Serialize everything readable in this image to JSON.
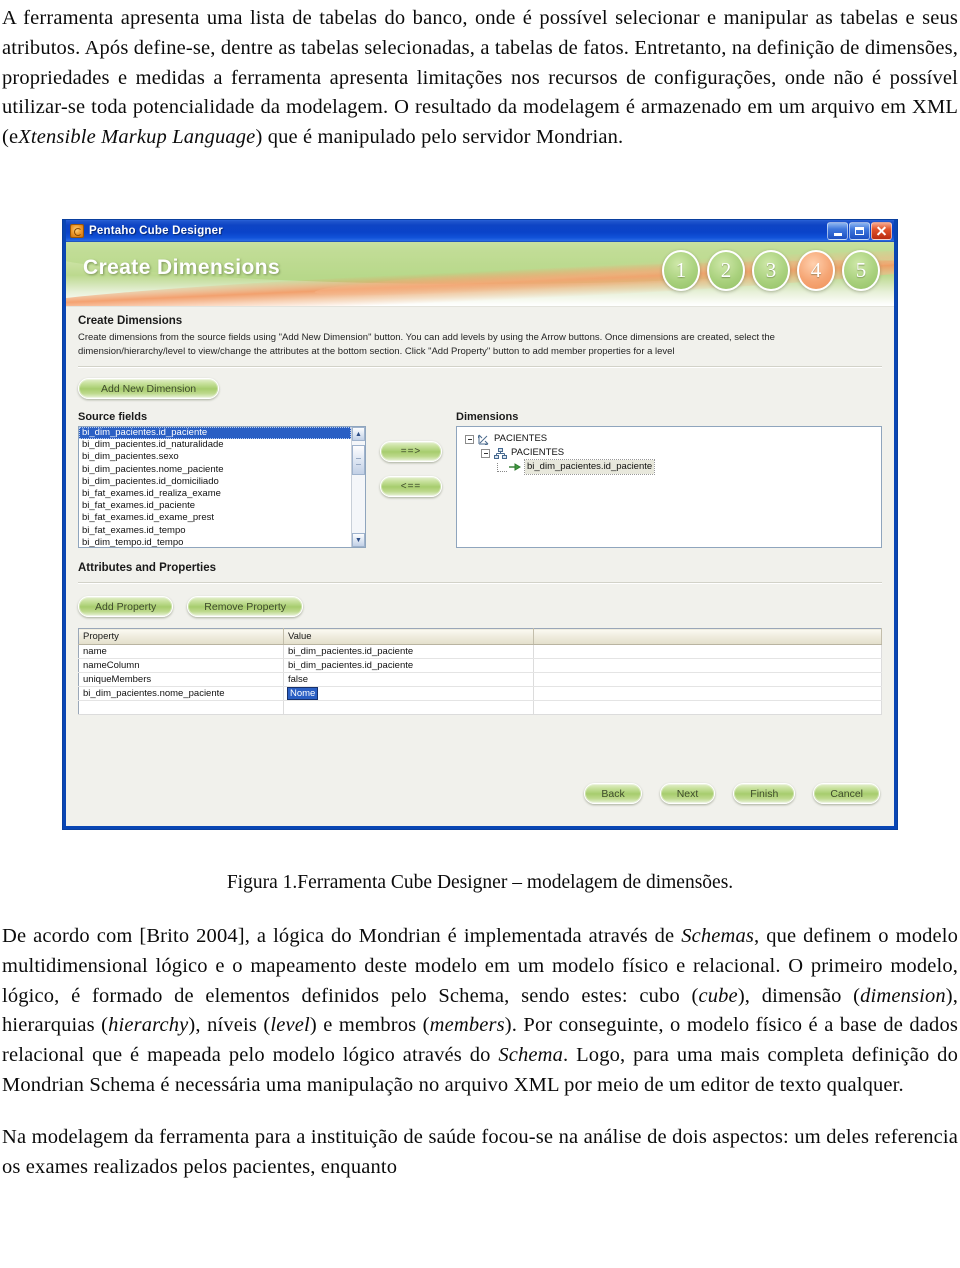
{
  "document": {
    "paragraph_top": "A ferramenta apresenta uma lista de tabelas do banco, onde é possível selecionar e manipular as tabelas e seus atributos. Após define-se, dentre as tabelas selecionadas, a tabelas de fatos. Entretanto, na definição de dimensões, propriedades e medidas a ferramenta apresenta limitações nos recursos de configurações, onde não é possível utilizar-se toda potencialidade da modelagem. O resultado da modelagem é armazenado em um arquivo em XML (eXtensible Markup Language) que é manipulado pelo servidor Mondrian.",
    "figure_caption": "Figura 1.Ferramenta Cube Designer – modelagem de dimensões.",
    "paragraph_after_1": "De acordo com [Brito 2004], a lógica do Mondrian é implementada através de Schemas, que definem o modelo multidimensional lógico e o mapeamento deste modelo em um modelo físico e relacional. O primeiro modelo, lógico, é formado de elementos definidos pelo Schema, sendo estes: cubo (cube), dimensão (dimension), hierarquias (hierarchy), níveis (level) e membros (members). Por conseguinte, o modelo físico é a base de dados relacional que é mapeada pelo modelo lógico através do Schema. Logo, para uma mais completa definição do Mondrian Schema é necessária uma manipulação no arquivo XML por meio de um editor de texto qualquer.",
    "paragraph_after_2": "Na modelagem da ferramenta para a instituição de saúde focou-se na análise de dois aspectos: um deles referencia os exames realizados pelos pacientes, enquanto"
  },
  "app": {
    "window_title": "Pentaho Cube Designer",
    "window_controls": {
      "minimize": "Minimize",
      "maximize": "Maximize",
      "close": "Close"
    },
    "banner": {
      "title": "Create Dimensions",
      "steps": [
        {
          "label": "1",
          "state": "inactive"
        },
        {
          "label": "2",
          "state": "inactive"
        },
        {
          "label": "3",
          "state": "inactive"
        },
        {
          "label": "4",
          "state": "active"
        },
        {
          "label": "5",
          "state": "inactive"
        }
      ],
      "active_color": "#f5a574",
      "inactive_color": "#a9d17d"
    },
    "section": {
      "heading": "Create Dimensions",
      "help": "Create dimensions from the source fields using \"Add New Dimension\" button. You can add levels by using the Arrow buttons. Once dimensions are created, select the dimension/hierarchy/level to view/change the attributes at the bottom section. Click \"Add Property\" button to add member properties for a level"
    },
    "add_new_dimension_label": "Add New Dimension",
    "source_fields": {
      "label": "Source fields",
      "items": [
        "bi_dim_pacientes.id_paciente",
        "bi_dim_pacientes.id_naturalidade",
        "bi_dim_pacientes.sexo",
        "bi_dim_pacientes.nome_paciente",
        "bi_dim_pacientes.id_domiciliado",
        "bi_fat_exames.id_realiza_exame",
        "bi_fat_exames.id_paciente",
        "bi_fat_exames.id_exame_prest",
        "bi_fat_exames.id_tempo",
        "bi_dim_tempo.id_tempo"
      ],
      "selected_index": 0
    },
    "transfer_buttons": {
      "add": "==>",
      "remove": "<=="
    },
    "dimensions": {
      "label": "Dimensions",
      "tree": [
        {
          "level": 1,
          "label": "PACIENTES",
          "icon": "dimension-icon",
          "expanded": true
        },
        {
          "level": 2,
          "label": "PACIENTES",
          "icon": "hierarchy-icon",
          "expanded": true
        },
        {
          "level": 3,
          "label": "bi_dim_pacientes.id_paciente",
          "icon": "level-icon",
          "selected": true
        }
      ]
    },
    "attributes": {
      "heading": "Attributes and Properties",
      "add_property_label": "Add Property",
      "remove_property_label": "Remove Property",
      "columns": [
        "Property",
        "Value",
        ""
      ],
      "rows": [
        {
          "property": "name",
          "value": "bi_dim_pacientes.id_paciente",
          "editing": false
        },
        {
          "property": "nameColumn",
          "value": "bi_dim_pacientes.id_paciente",
          "editing": false
        },
        {
          "property": "uniqueMembers",
          "value": "false",
          "editing": false
        },
        {
          "property": "bi_dim_pacientes.nome_paciente",
          "value": "Nome",
          "editing": true
        }
      ]
    },
    "wizard_buttons": {
      "back": "Back",
      "next": "Next",
      "finish": "Finish",
      "cancel": "Cancel"
    }
  }
}
